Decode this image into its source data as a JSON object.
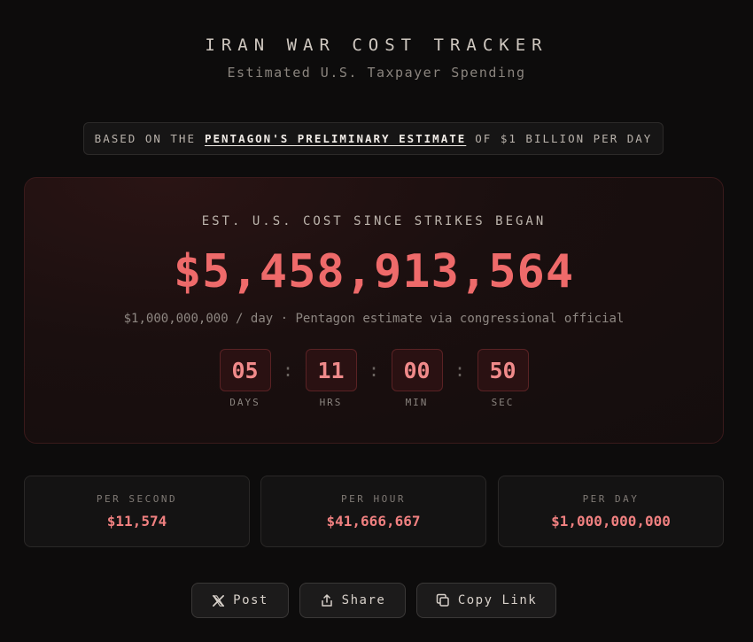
{
  "header": {
    "title": "IRAN WAR COST TRACKER",
    "subtitle": "Estimated U.S. Taxpayer Spending"
  },
  "source": {
    "prefix": "BASED ON THE",
    "link_text": "PENTAGON'S PRELIMINARY ESTIMATE",
    "suffix": "OF $1 BILLION PER DAY"
  },
  "hero": {
    "label": "EST. U.S. COST SINCE STRIKES BEGAN",
    "amount": "$5,458,913,564",
    "rate_note": "$1,000,000,000 / day · Pentagon estimate via congressional official",
    "timer": [
      {
        "value": "05",
        "label": "DAYS"
      },
      {
        "value": "11",
        "label": "HRS"
      },
      {
        "value": "00",
        "label": "MIN"
      },
      {
        "value": "50",
        "label": "SEC"
      }
    ],
    "separator": ":"
  },
  "stats": [
    {
      "label": "PER SECOND",
      "value": "$11,574"
    },
    {
      "label": "PER HOUR",
      "value": "$41,666,667"
    },
    {
      "label": "PER DAY",
      "value": "$1,000,000,000"
    }
  ],
  "actions": {
    "post": {
      "label": "Post",
      "icon": "x-logo-icon"
    },
    "share": {
      "label": "Share",
      "icon": "share-icon"
    },
    "copy": {
      "label": "Copy Link",
      "icon": "copy-icon"
    }
  },
  "colors": {
    "background": "#0d0c0c",
    "accent_red": "#ee6a6a",
    "timer_box": "#2a1112"
  }
}
